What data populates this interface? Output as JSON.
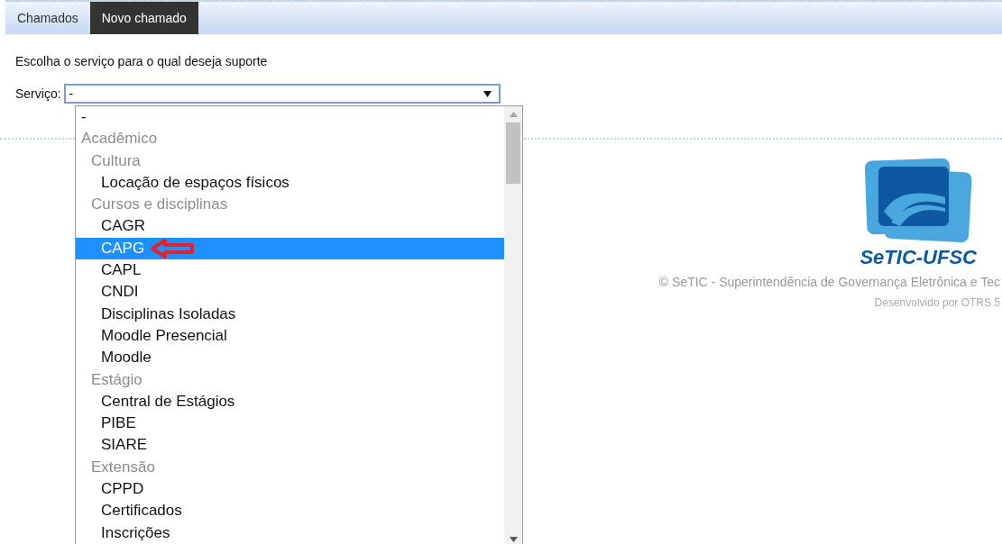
{
  "tabs": [
    {
      "label": "Chamados",
      "selected": false
    },
    {
      "label": "Novo chamado",
      "selected": true
    }
  ],
  "prompt": "Escolha o serviço para o qual deseja suporte",
  "service_field": {
    "label": "Serviço:",
    "value": "-",
    "expanded": true
  },
  "dropdown": {
    "options": [
      {
        "label": "-",
        "kind": "option",
        "selected": false
      },
      {
        "label": "Acadêmico",
        "kind": "group",
        "children": [
          {
            "label": "Cultura",
            "kind": "group",
            "children": [
              {
                "label": "Locação de espaços físicos",
                "kind": "option",
                "selected": false
              }
            ]
          },
          {
            "label": "Cursos e disciplinas",
            "kind": "group",
            "children": [
              {
                "label": "CAGR",
                "kind": "option",
                "selected": false
              },
              {
                "label": "CAPG",
                "kind": "option",
                "selected": true
              },
              {
                "label": "CAPL",
                "kind": "option",
                "selected": false
              },
              {
                "label": "CNDI",
                "kind": "option",
                "selected": false
              },
              {
                "label": "Disciplinas Isoladas",
                "kind": "option",
                "selected": false
              },
              {
                "label": "Moodle Presencial",
                "kind": "option",
                "selected": false
              },
              {
                "label": "Moodle",
                "kind": "option",
                "selected": false
              }
            ]
          },
          {
            "label": "Estágio",
            "kind": "group",
            "children": [
              {
                "label": "Central de Estágios",
                "kind": "option",
                "selected": false
              },
              {
                "label": "PIBE",
                "kind": "option",
                "selected": false
              },
              {
                "label": "SIARE",
                "kind": "option",
                "selected": false
              }
            ]
          },
          {
            "label": "Extensão",
            "kind": "group",
            "children": [
              {
                "label": "CPPD",
                "kind": "option",
                "selected": false
              },
              {
                "label": "Certificados",
                "kind": "option",
                "selected": false
              },
              {
                "label": "Inscrições",
                "kind": "option",
                "selected": false
              }
            ]
          }
        ]
      }
    ]
  },
  "logo": {
    "name": "SeTIC-UFSC"
  },
  "footer": {
    "copyright": "© SeTIC - Superintendência de Governança Eletrônica e Tec",
    "credit": "Desenvolvido por OTRS 5"
  }
}
